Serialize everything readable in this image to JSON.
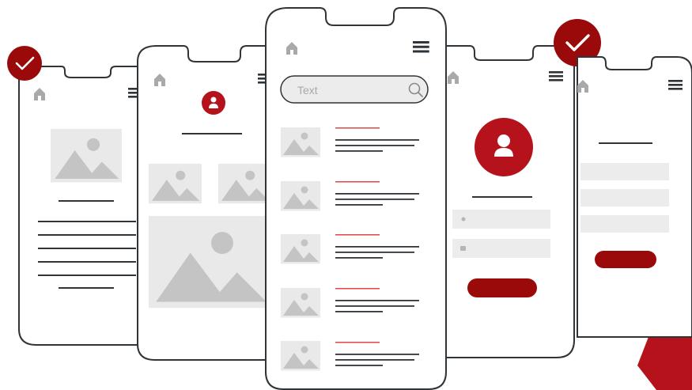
{
  "search": {
    "placeholder": "Text"
  },
  "colors": {
    "accent": "#9a0a0a",
    "accent_bright": "#b5121b",
    "phone_outline": "#2f3438",
    "placeholder_gray": "#c4c4c4",
    "panel_gray": "#e9e9e9",
    "field_gray": "#ececec"
  },
  "icons": [
    "check-icon",
    "home-icon",
    "menu-icon",
    "avatar-icon",
    "image-placeholder-icon",
    "search-icon",
    "gear-icon"
  ]
}
